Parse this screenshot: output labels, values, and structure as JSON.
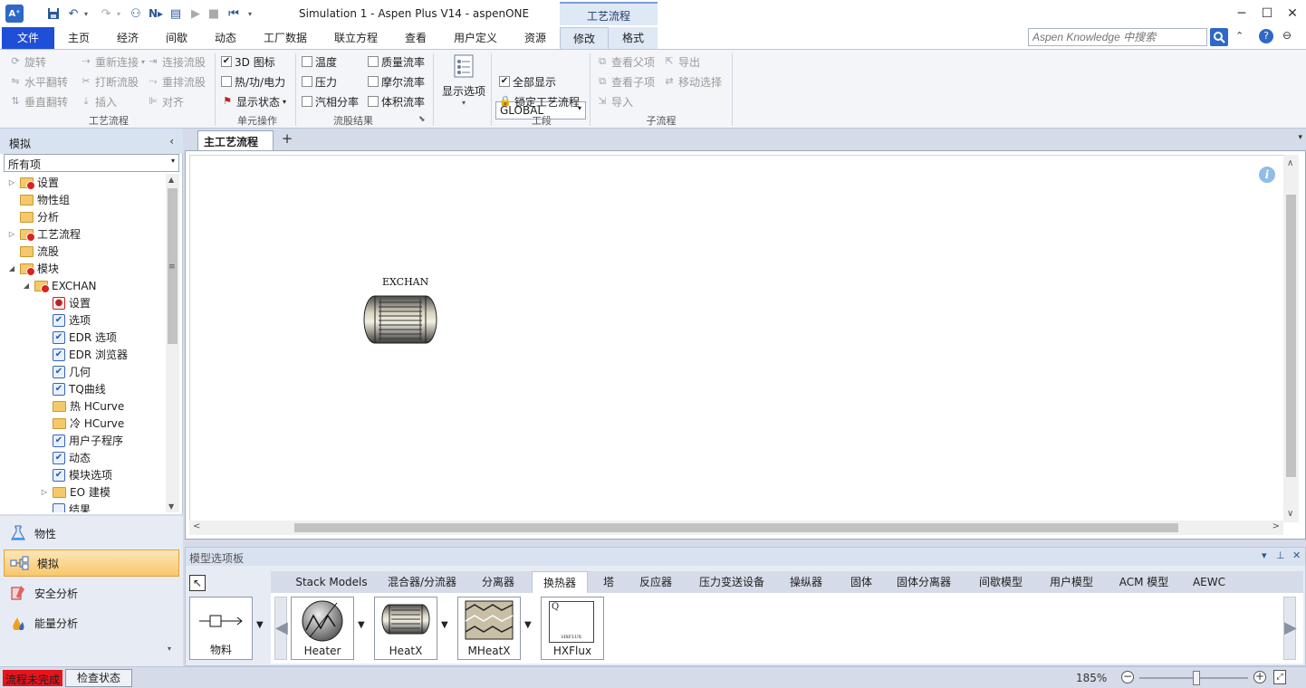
{
  "window": {
    "title": "Simulation 1 - Aspen Plus V14 - aspenONE",
    "context_tab_header": "工艺流程"
  },
  "ribbon_tabs": [
    {
      "label": "文件"
    },
    {
      "label": "主页"
    },
    {
      "label": "经济"
    },
    {
      "label": "间歇"
    },
    {
      "label": "动态"
    },
    {
      "label": "工厂数据"
    },
    {
      "label": "联立方程"
    },
    {
      "label": "查看"
    },
    {
      "label": "用户定义"
    },
    {
      "label": "资源"
    },
    {
      "label": "修改"
    },
    {
      "label": "格式"
    }
  ],
  "search": {
    "placeholder": "Aspen Knowledge 中搜索"
  },
  "ribbon": {
    "flowsheet_group": {
      "label": "工艺流程",
      "rotate": "旋转",
      "flip_h": "水平翻转",
      "flip_v": "垂直翻转",
      "reconnect": "重新连接",
      "break_stream": "打断流股",
      "insert": "插入",
      "connect_stream": "连接流股",
      "reroute_stream": "重排流股",
      "align": "对齐"
    },
    "unit_ops_group": {
      "label": "单元操作",
      "icon_3d": "3D 图标",
      "heat_work_power": "热/功/电力",
      "show_status": "显示状态"
    },
    "stream_results_group": {
      "label": "流股结果",
      "temperature": "温度",
      "pressure": "压力",
      "vapor_fraction": "汽相分率",
      "mass_flow": "质量流率",
      "molar_flow": "摩尔流率",
      "volume_flow": "体积流率"
    },
    "display_options": {
      "label": "显示选项"
    },
    "section_group": {
      "label": "工段",
      "selected": "GLOBAL",
      "show_all": "全部显示",
      "lock_flowsheet": "锁定工艺流程"
    },
    "subflowsheet_group": {
      "label": "子流程",
      "view_parent": "查看父项",
      "view_child": "查看子项",
      "import": "导入",
      "export": "导出",
      "move_selection": "移动选择"
    }
  },
  "nav": {
    "header": "模拟",
    "filter": "所有项",
    "tree": [
      {
        "label": "设置"
      },
      {
        "label": "物性组"
      },
      {
        "label": "分析"
      },
      {
        "label": "工艺流程"
      },
      {
        "label": "流股"
      },
      {
        "label": "模块"
      },
      {
        "label": "EXCHAN"
      },
      {
        "label": "设置"
      },
      {
        "label": "选项"
      },
      {
        "label": "EDR 选项"
      },
      {
        "label": "EDR 浏览器"
      },
      {
        "label": "几何"
      },
      {
        "label": "TQ曲线"
      },
      {
        "label": "热 HCurve"
      },
      {
        "label": "冷 HCurve"
      },
      {
        "label": "用户子程序"
      },
      {
        "label": "动态"
      },
      {
        "label": "模块选项"
      },
      {
        "label": "EO 建模"
      },
      {
        "label": "结果"
      }
    ],
    "buttons": [
      {
        "label": "物性"
      },
      {
        "label": "模拟"
      },
      {
        "label": "安全分析"
      },
      {
        "label": "能量分析"
      }
    ]
  },
  "doc_tab": {
    "label": "主工艺流程",
    "close": "×"
  },
  "canvas": {
    "block_label": "EXCHAN",
    "info": "i"
  },
  "palette": {
    "header": "模型选项板",
    "tabs": [
      {
        "label": "Stack Models"
      },
      {
        "label": "混合器/分流器"
      },
      {
        "label": "分离器"
      },
      {
        "label": "换热器"
      },
      {
        "label": "塔"
      },
      {
        "label": "反应器"
      },
      {
        "label": "压力变送设备"
      },
      {
        "label": "操纵器"
      },
      {
        "label": "固体"
      },
      {
        "label": "固体分离器"
      },
      {
        "label": "间歇模型"
      },
      {
        "label": "用户模型"
      },
      {
        "label": "ACM 模型"
      },
      {
        "label": "AEWC"
      }
    ],
    "models": [
      {
        "label": "物料"
      },
      {
        "label": "Heater"
      },
      {
        "label": "HeatX"
      },
      {
        "label": "MHeatX"
      },
      {
        "label": "HXFlux"
      }
    ],
    "hxflux_q": "Q",
    "hxflux_text": "HXFLUX"
  },
  "status": {
    "error": "流程未完成",
    "check_button": "检查状态",
    "zoom": "185%"
  },
  "colors": {
    "file_tab": "#1f4fd8",
    "status_error": "#e8141c",
    "nav_selected": "#f8c76a"
  }
}
